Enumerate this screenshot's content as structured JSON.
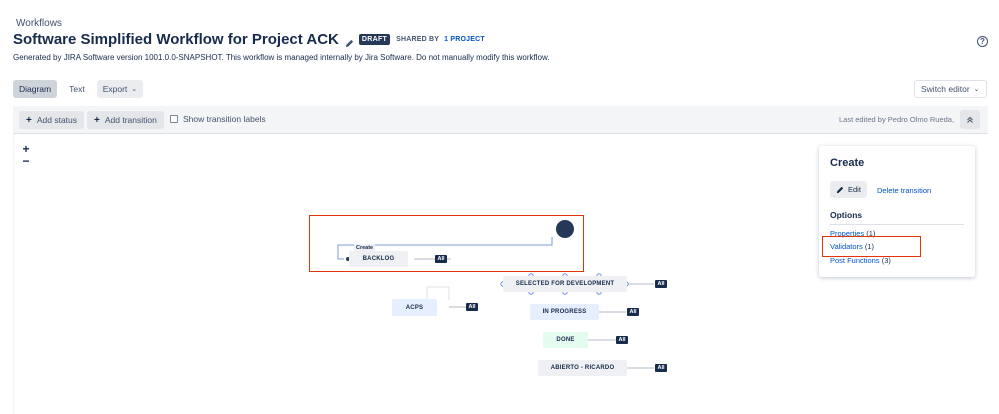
{
  "header": {
    "breadcrumb": "Workflows",
    "title": "Software Simplified Workflow for Project ACK",
    "draft_badge": "DRAFT",
    "shared_prefix": "SHARED BY",
    "shared_link": "1 PROJECT",
    "description": "Generated by JIRA Software version 1001.0.0-SNAPSHOT. This workflow is managed internally by Jira Software. Do not manually modify this workflow.",
    "help_glyph": "?"
  },
  "view_tabs": {
    "diagram": "Diagram",
    "text": "Text",
    "export": "Export"
  },
  "switch_editor": "Switch editor",
  "toolbar": {
    "add_status": "Add status",
    "add_transition": "Add transition",
    "show_labels": "Show transition labels",
    "show_labels_checked": false,
    "last_edited": "Last edited by Pedro Olmo Rueda,"
  },
  "zoom": {
    "in": "+",
    "out": "−"
  },
  "diagram": {
    "transition_label": "Create",
    "all_label": "All",
    "statuses": {
      "backlog": "BACKLOG",
      "selected": "SELECTED FOR DEVELOPMENT",
      "acps": "ACPS",
      "in_progress": "IN PROGRESS",
      "done": "DONE",
      "abierto": "ABIERTO - RICARDO"
    }
  },
  "side_panel": {
    "title": "Create",
    "edit_label": "Edit",
    "delete_label": "Delete transition",
    "options_heading": "Options",
    "options": [
      {
        "label": "Properties",
        "count": "(1)"
      },
      {
        "label": "Validators",
        "count": "(1)"
      },
      {
        "label": "Post Functions",
        "count": "(3)"
      }
    ]
  },
  "colors": {
    "highlight": "#de350b",
    "link": "#0052cc",
    "status_todo": "#eef0f3",
    "status_in_progress": "#e6efff",
    "status_done": "#e3fcef"
  }
}
